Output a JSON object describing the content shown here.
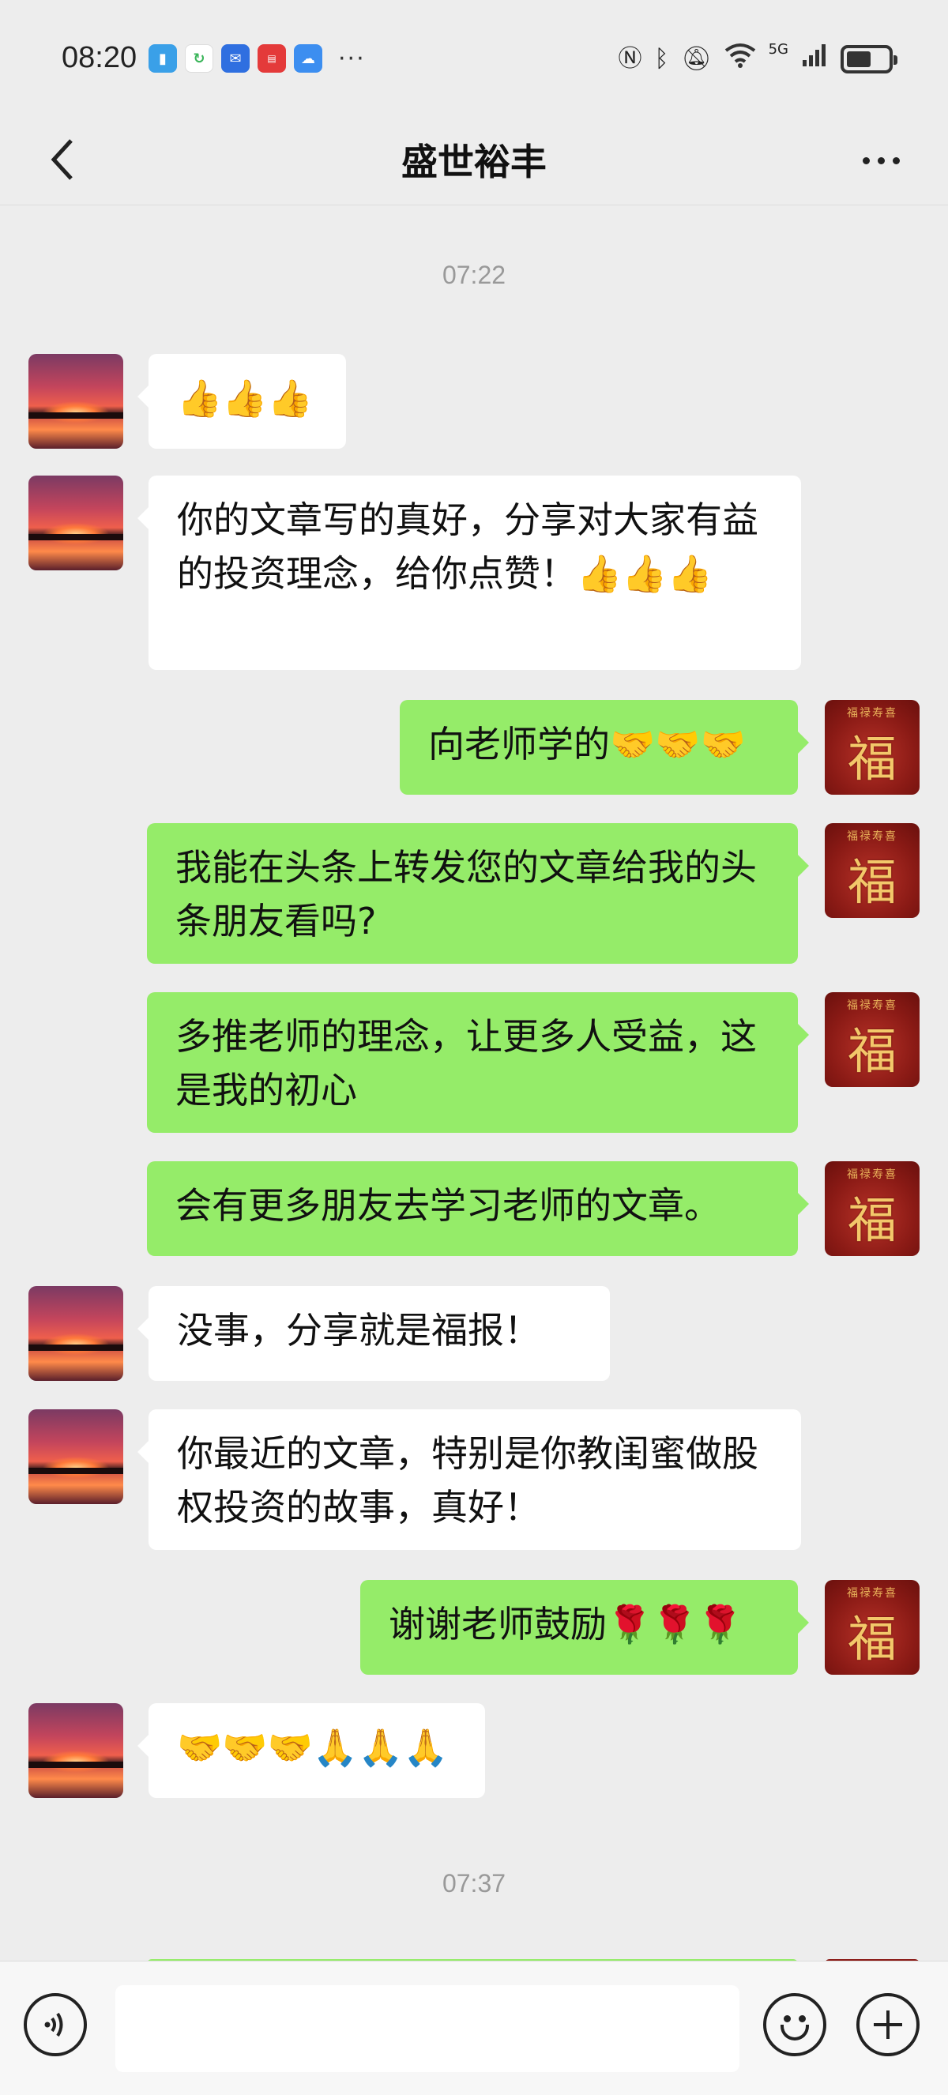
{
  "status_bar": {
    "time": "08:20",
    "more": "···",
    "network": "5G",
    "apps": [
      "book-app-icon",
      "recycle-app-icon",
      "shop-app-icon",
      "red-app-icon",
      "cloud-app-icon"
    ]
  },
  "nav": {
    "title": "盛世裕丰"
  },
  "timestamps": {
    "first": "07:22",
    "second": "07:37"
  },
  "messages": [
    {
      "side": "left",
      "text": "👍👍👍"
    },
    {
      "side": "left",
      "text": "你的文章写的真好，分享对大家有益的投资理念，给你点赞！👍👍👍"
    },
    {
      "side": "right",
      "text": "向老师学的🤝🤝🤝"
    },
    {
      "side": "right",
      "text": "我能在头条上转发您的文章给我的头条朋友看吗?"
    },
    {
      "side": "right",
      "text": "多推老师的理念，让更多人受益，这是我的初心"
    },
    {
      "side": "right",
      "text": "会有更多朋友去学习老师的文章。"
    },
    {
      "side": "left",
      "text": "没事，分享就是福报！"
    },
    {
      "side": "left",
      "text": "你最近的文章，特别是你教闺蜜做股权投资的故事，真好！"
    },
    {
      "side": "right",
      "text": "谢谢老师鼓励🌹🌹🌹"
    },
    {
      "side": "left",
      "text": "🤝🤝🤝🙏🙏🙏"
    }
  ],
  "avatar_right_char": "福",
  "colors": {
    "background": "#ededed",
    "bubble_right": "#95ec69",
    "bubble_left": "#ffffff",
    "timestamp": "#999999"
  }
}
